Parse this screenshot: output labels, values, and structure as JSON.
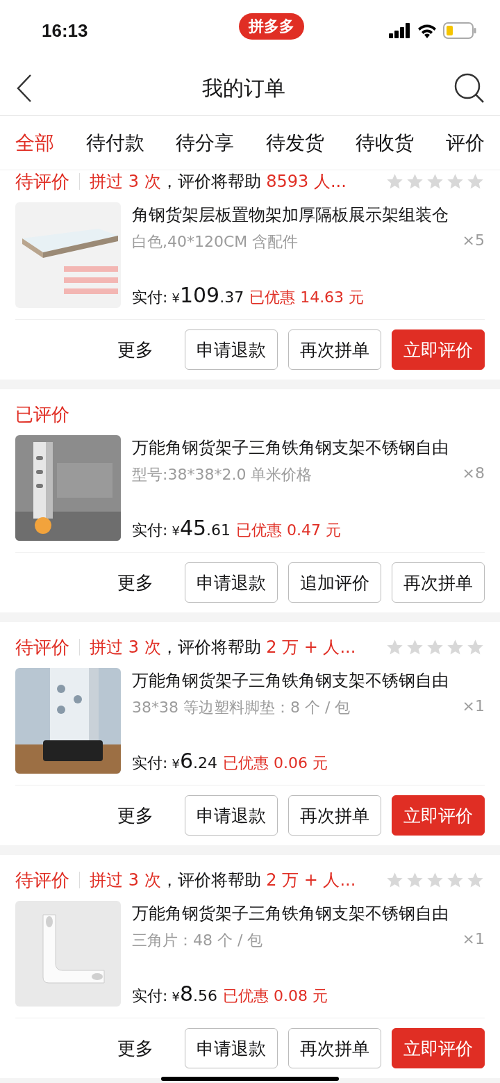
{
  "status_bar": {
    "time": "16:13",
    "app_badge": "拼多多"
  },
  "nav": {
    "title": "我的订单"
  },
  "tabs": [
    {
      "label": "全部",
      "selected": true
    },
    {
      "label": "待付款",
      "selected": false
    },
    {
      "label": "待分享",
      "selected": false
    },
    {
      "label": "待发货",
      "selected": false
    },
    {
      "label": "待收货",
      "selected": false
    },
    {
      "label": "评价",
      "selected": false
    }
  ],
  "orders": [
    {
      "status": "待评价",
      "note": [
        {
          "text": "拼过 3 次",
          "highlight": true
        },
        {
          "text": "，评价将帮助 ",
          "highlight": false
        },
        {
          "text": "8593 人...",
          "highlight": true
        }
      ],
      "stars": 0,
      "title": "角钢货架层板置物架加厚隔板展示架组装仓",
      "spec": "白色,40*120CM 含配件",
      "qty": "×5",
      "paid_label": "实付:",
      "currency": "¥",
      "price_int": "109",
      "price_dec": ".37",
      "discount": "已优惠 14.63 元",
      "more": "更多",
      "buttons": [
        {
          "label": "申请退款",
          "primary": false
        },
        {
          "label": "再次拼单",
          "primary": false
        },
        {
          "label": "立即评价",
          "primary": true
        }
      ]
    },
    {
      "status": "已评价",
      "title": "万能角钢货架子三角铁角钢支架不锈钢自由",
      "spec": "型号:38*38*2.0 单米价格",
      "qty": "×8",
      "paid_label": "实付:",
      "currency": "¥",
      "price_int": "45",
      "price_dec": ".61",
      "discount": "已优惠 0.47 元",
      "more": "更多",
      "buttons": [
        {
          "label": "申请退款",
          "primary": false
        },
        {
          "label": "追加评价",
          "primary": false
        },
        {
          "label": "再次拼单",
          "primary": false
        }
      ]
    },
    {
      "status": "待评价",
      "note": [
        {
          "text": "拼过 3 次",
          "highlight": true
        },
        {
          "text": "，评价将帮助 ",
          "highlight": false
        },
        {
          "text": "2 万 + 人...",
          "highlight": true
        }
      ],
      "stars": 0,
      "title": "万能角钢货架子三角铁角钢支架不锈钢自由",
      "spec": "38*38 等边塑料脚垫：8 个 / 包",
      "qty": "×1",
      "paid_label": "实付:",
      "currency": "¥",
      "price_int": "6",
      "price_dec": ".24",
      "discount": "已优惠 0.06 元",
      "more": "更多",
      "buttons": [
        {
          "label": "申请退款",
          "primary": false
        },
        {
          "label": "再次拼单",
          "primary": false
        },
        {
          "label": "立即评价",
          "primary": true
        }
      ]
    },
    {
      "status": "待评价",
      "note": [
        {
          "text": "拼过 3 次",
          "highlight": true
        },
        {
          "text": "，评价将帮助 ",
          "highlight": false
        },
        {
          "text": "2 万 + 人...",
          "highlight": true
        }
      ],
      "stars": 0,
      "title": "万能角钢货架子三角铁角钢支架不锈钢自由",
      "spec": "三角片：48 个 / 包",
      "qty": "×1",
      "paid_label": "实付:",
      "currency": "¥",
      "price_int": "8",
      "price_dec": ".56",
      "discount": "已优惠 0.08 元",
      "more": "更多",
      "buttons": [
        {
          "label": "申请退款",
          "primary": false
        },
        {
          "label": "再次拼单",
          "primary": false
        },
        {
          "label": "立即评价",
          "primary": true
        }
      ]
    }
  ]
}
